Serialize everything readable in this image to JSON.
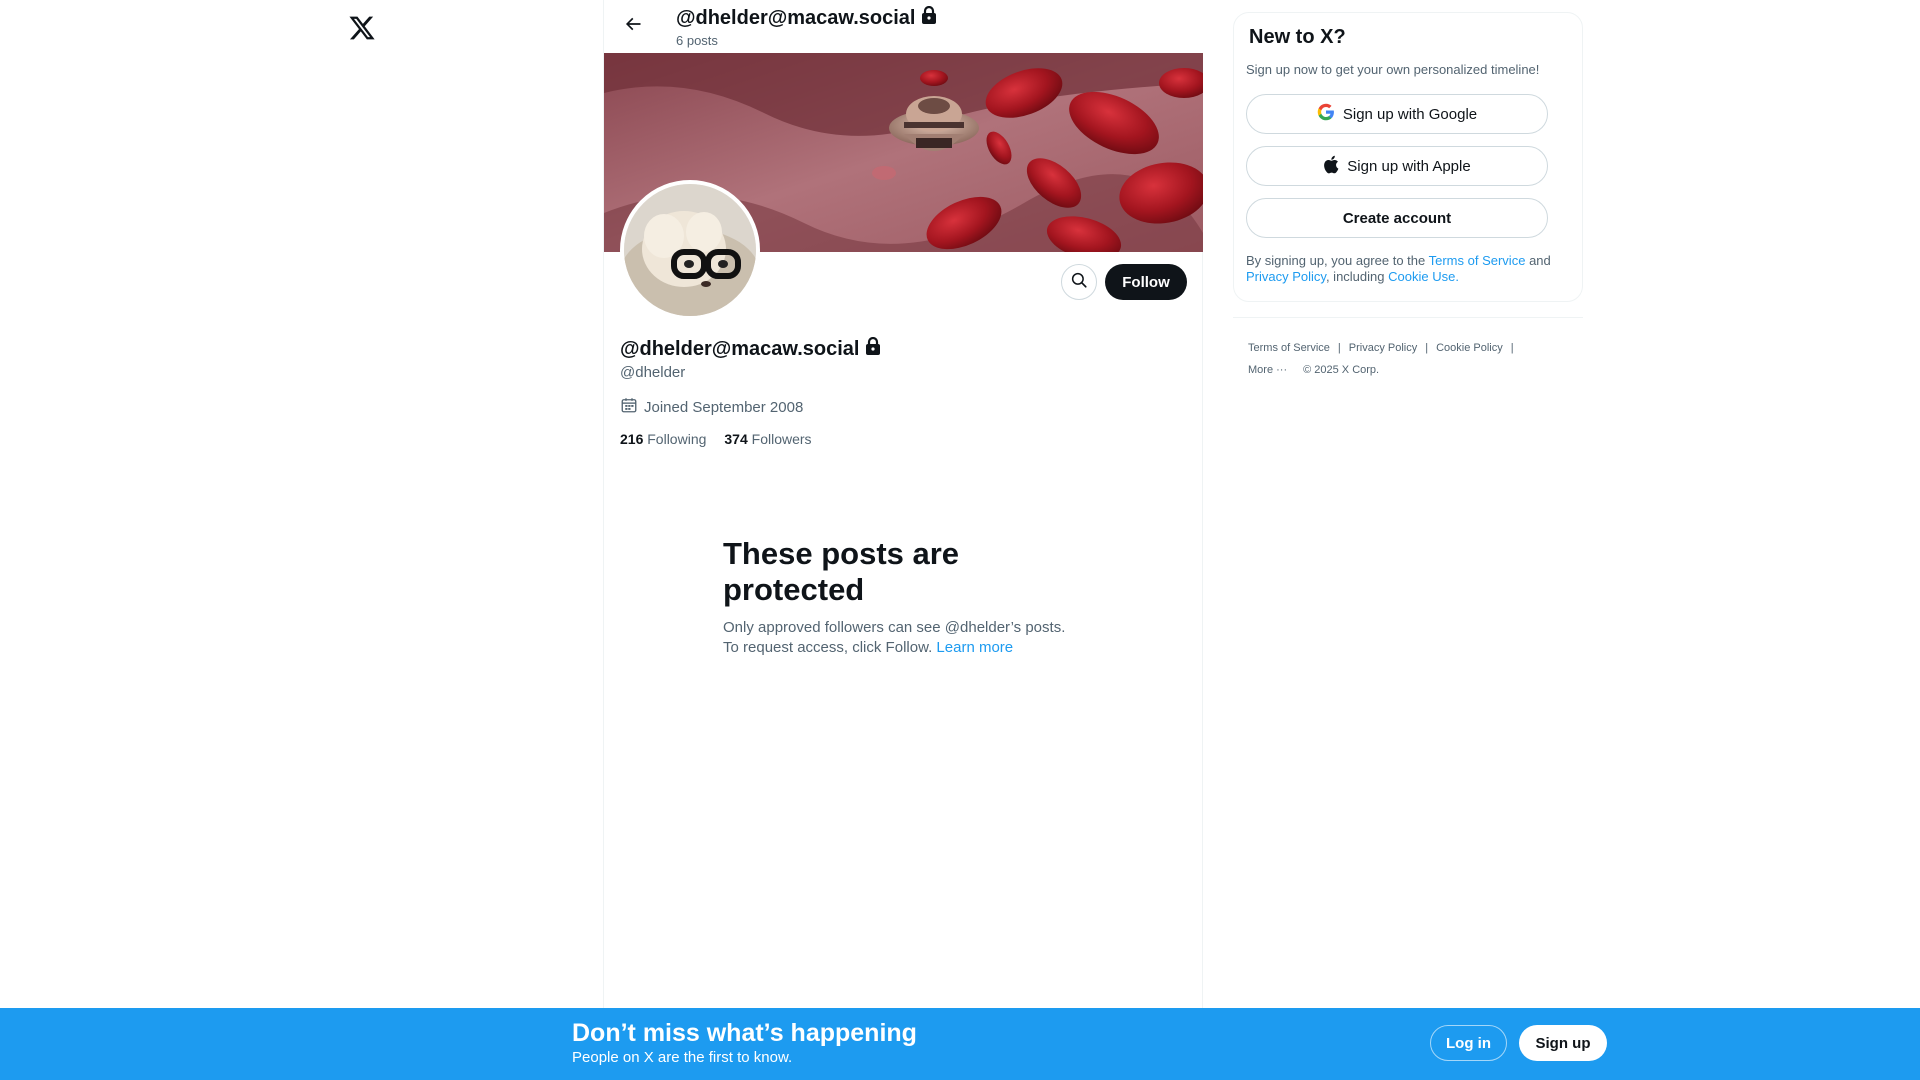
{
  "header": {
    "title": "@dhelder@macaw.social",
    "post_count": "6 posts"
  },
  "profile": {
    "display_name": "@dhelder@macaw.social",
    "handle": "@dhelder",
    "joined": "Joined September 2008",
    "following_count": "216",
    "following_label": "Following",
    "followers_count": "374",
    "followers_label": "Followers",
    "follow_label": "Follow"
  },
  "protected": {
    "heading": "These posts are protected",
    "body_1": "Only approved followers can see @dhelder’s posts.",
    "body_2": "To request access, click Follow.",
    "learn_more": "Learn more"
  },
  "signup": {
    "title": "New to X?",
    "subtitle": "Sign up now to get your own personalized timeline!",
    "google": "Sign up with Google",
    "apple": "Sign up with Apple",
    "create": "Create account",
    "terms_prefix": "By signing up, you agree to the",
    "terms_link": "Terms of Service",
    "terms_and": "and",
    "privacy_link": "Privacy Policy",
    "including": ", including",
    "cookie_link": "Cookie Use."
  },
  "footer": {
    "terms": "Terms of Service",
    "privacy": "Privacy Policy",
    "cookie": "Cookie Policy",
    "more": "More ···",
    "copyright": "© 2025 X Corp."
  },
  "bottom_bar": {
    "heading": "Don’t miss what’s happening",
    "subheading": "People on X are the first to know.",
    "login": "Log in",
    "signup": "Sign up"
  },
  "colors": {
    "accent": "#1d9bf0",
    "text_primary": "#0f1419",
    "text_secondary": "#536471",
    "border": "#eff3f4"
  },
  "icons": {
    "logo": "x-logo-icon",
    "back": "arrow-left-icon",
    "lock": "lock-icon",
    "search": "search-icon",
    "calendar": "calendar-icon",
    "google": "google-icon",
    "apple": "apple-icon"
  }
}
